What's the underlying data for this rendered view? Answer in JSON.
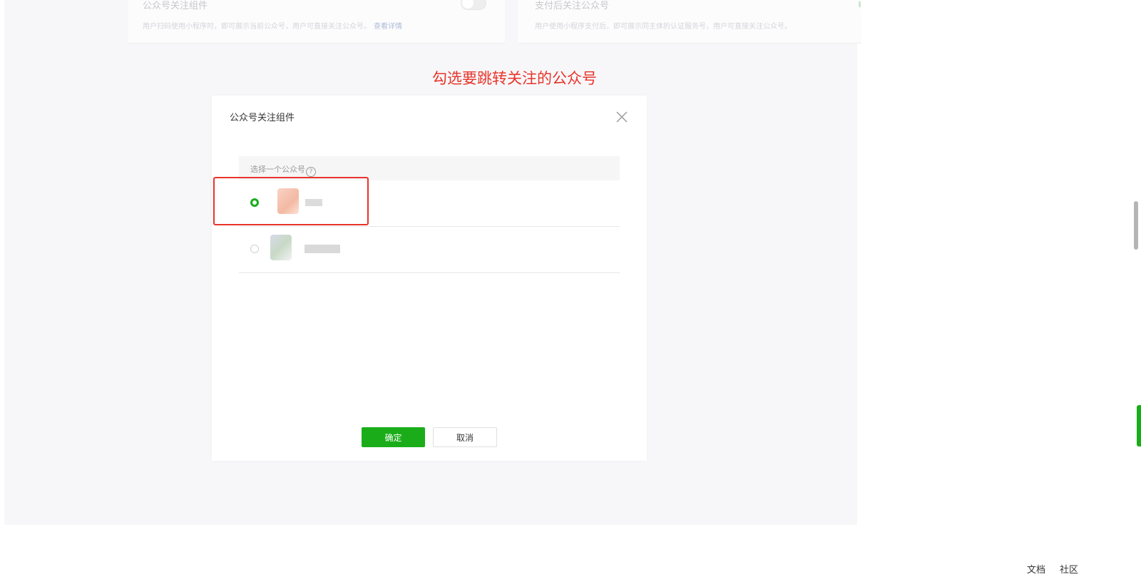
{
  "cards": {
    "left": {
      "title": "公众号关注组件",
      "description": "用户扫码使用小程序时，即可展示当前公众号，用户可直接关注公众号。",
      "link": "查看详情"
    },
    "right": {
      "title": "支付后关注公众号",
      "description": "用户使用小程序支付后，即可展示同主体的认证服务号，用户可直接关注公众号。"
    }
  },
  "annotation": {
    "text": "勾选要跳转关注的公众号",
    "color": "#e8342a"
  },
  "dialog": {
    "title": "公众号关注组件",
    "list_header": "选择一个公众号",
    "help_icon": "?",
    "options": [
      {
        "selected": true
      },
      {
        "selected": false
      }
    ],
    "confirm_label": "确定",
    "cancel_label": "取消"
  },
  "footer": {
    "links": [
      "文档",
      "社区"
    ]
  },
  "colors": {
    "accent": "#1aad19",
    "annotation": "#e8342a"
  }
}
